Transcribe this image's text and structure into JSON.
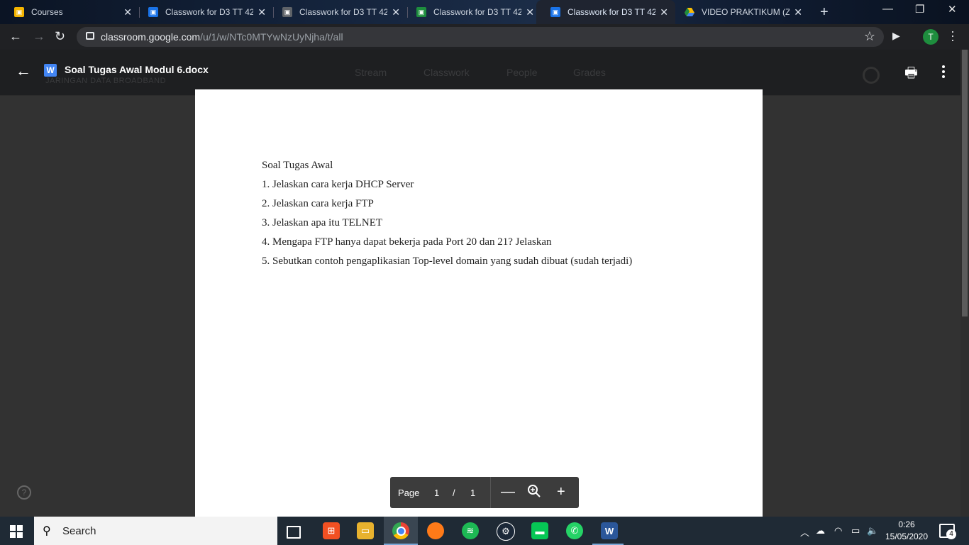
{
  "tabs": [
    {
      "title": "Courses",
      "active": false,
      "favicon_color": "#f4b400",
      "favicon": "classroom-icon"
    },
    {
      "title": "Classwork for D3 TT 42",
      "active": false,
      "favicon_color": "#1a73e8",
      "favicon": "classroom-icon"
    },
    {
      "title": "Classwork for D3 TT 42",
      "active": false,
      "favicon_color": "#5f6368",
      "favicon": "classroom-icon"
    },
    {
      "title": "Classwork for D3 TT 42",
      "active": false,
      "favicon_color": "#1e8e3e",
      "favicon": "classroom-icon"
    },
    {
      "title": "Classwork for D3 TT 42",
      "active": true,
      "favicon_color": "#1a73e8",
      "favicon": "classroom-icon"
    },
    {
      "title": "VIDEO PRAKTIKUM (ZO",
      "active": false,
      "favicon_color": "#fbbc04",
      "favicon": "google-drive-icon"
    }
  ],
  "address": {
    "host": "classroom.google.com",
    "path": "/u/1/w/NTc0MTYwNzUyNjha/t/all"
  },
  "profile_initial": "T",
  "classroom": {
    "subtitle": "JARINGAN DATA BROADBAND",
    "nav": [
      "Stream",
      "Classwork",
      "People",
      "Grades"
    ]
  },
  "viewer": {
    "file_icon_letter": "W",
    "file_name": "Soal Tugas Awal Modul 6.docx",
    "document_lines": [
      "Soal Tugas Awal",
      "1. Jelaskan cara kerja DHCP Server",
      "2. Jelaskan cara kerja FTP",
      "3. Jelaskan apa itu TELNET",
      "4. Mengapa FTP hanya dapat bekerja pada Port 20 dan 21? Jelaskan",
      "5. Sebutkan contoh pengaplikasian Top-level domain yang sudah dibuat (sudah terjadi)"
    ],
    "page_label": "Page",
    "current_page": "1",
    "page_separator": "/",
    "total_pages": "1"
  },
  "taskbar": {
    "search_label": "Search",
    "time": "0:26",
    "date": "15/05/2020",
    "notification_count": "4"
  },
  "colors": {
    "overlay_bg": "#323232",
    "page_bg": "#ffffff",
    "accent_blue": "#4285f4",
    "taskbar": "#1f2a35"
  }
}
